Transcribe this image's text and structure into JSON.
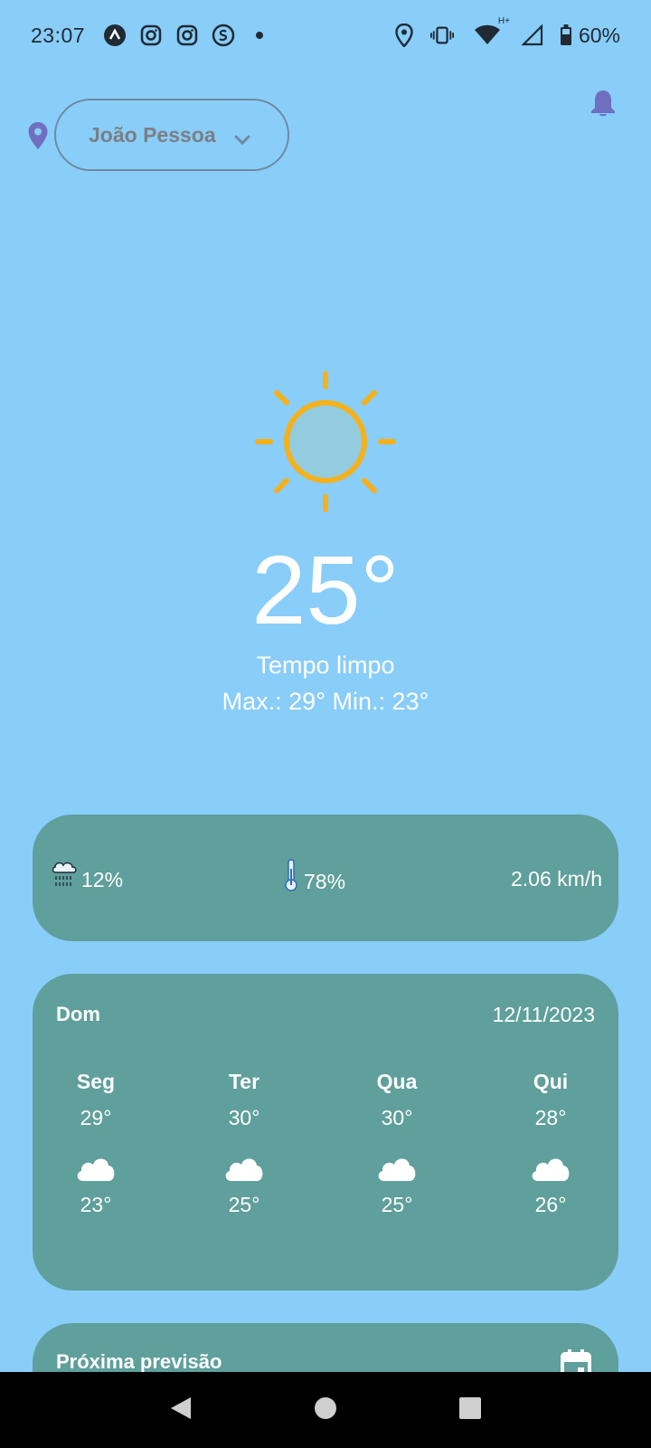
{
  "status_bar": {
    "time": "23:07",
    "battery": "60%",
    "network_label": "H+",
    "left_icons": [
      "app-a-icon",
      "instagram-icon",
      "instagram-icon",
      "s-app-icon",
      "dot-icon"
    ],
    "right_icons": [
      "location-icon",
      "vibrate-icon",
      "wifi-icon",
      "signal-icon",
      "battery-icon"
    ]
  },
  "location": {
    "city": "João Pessoa"
  },
  "current": {
    "temperature": "25°",
    "condition": "Tempo limpo",
    "max_min": "Max.: 29° Min.: 23°",
    "icon": "sun-icon"
  },
  "stats": {
    "rain": "12%",
    "humidity": "78%",
    "wind": "2.06 km/h"
  },
  "forecast": {
    "today_label": "Dom",
    "date": "12/11/2023",
    "days": [
      {
        "name": "Seg",
        "max": "29°",
        "min": "23°",
        "icon": "cloud-icon"
      },
      {
        "name": "Ter",
        "max": "30°",
        "min": "25°",
        "icon": "cloud-icon"
      },
      {
        "name": "Qua",
        "max": "30°",
        "min": "25°",
        "icon": "cloud-icon"
      },
      {
        "name": "Qui",
        "max": "28°",
        "min": "26°",
        "icon": "cloud-icon"
      }
    ]
  },
  "next": {
    "title": "Próxima previsão"
  },
  "colors": {
    "background": "#89CDF9",
    "card": "#5F9F9C",
    "sun": "#F5B11B",
    "accent": "#6F6FC0"
  }
}
